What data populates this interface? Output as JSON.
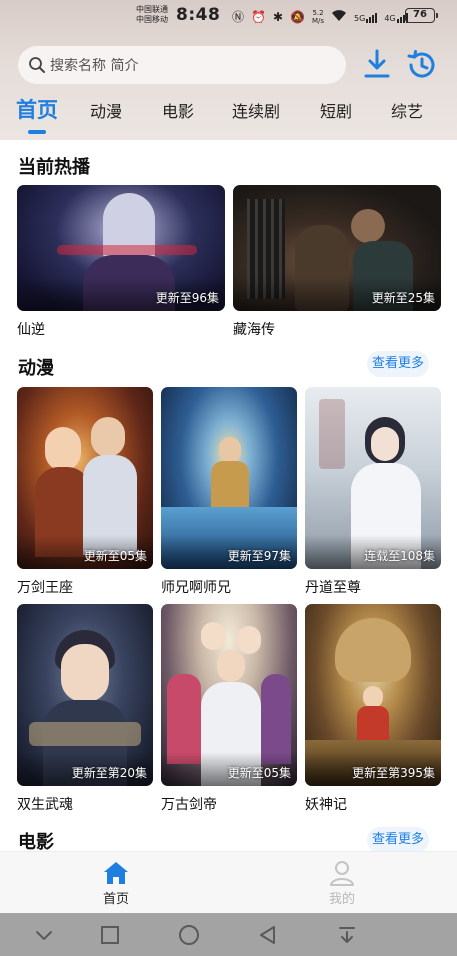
{
  "status_bar": {
    "carrier_1": "中国联通",
    "carrier_2": "中国移动",
    "time": "8:48",
    "speed_value": "5.2",
    "speed_unit": "M/s",
    "network_1": "5G",
    "network_2": "4G",
    "battery": "76"
  },
  "search": {
    "placeholder": "搜索名称 简介"
  },
  "tabs": [
    {
      "label": "首页",
      "active": true
    },
    {
      "label": "动漫",
      "active": false
    },
    {
      "label": "电影",
      "active": false
    },
    {
      "label": "连续剧",
      "active": false
    },
    {
      "label": "短剧",
      "active": false
    },
    {
      "label": "综艺",
      "active": false
    }
  ],
  "sections": {
    "now_playing": {
      "title": "当前热播",
      "items": [
        {
          "title": "仙逆",
          "badge": "更新至96集"
        },
        {
          "title": "藏海传",
          "badge": "更新至25集"
        }
      ]
    },
    "anime": {
      "title": "动漫",
      "more_label": "查看更多",
      "items": [
        {
          "title": "万剑王座",
          "badge": "更新至05集"
        },
        {
          "title": "师兄啊师兄",
          "badge": "更新至97集"
        },
        {
          "title": "丹道至尊",
          "badge": "连载至108集"
        },
        {
          "title": "双生武魂",
          "badge": "更新至第20集"
        },
        {
          "title": "万古剑帝",
          "badge": "更新至05集"
        },
        {
          "title": "妖神记",
          "badge": "更新至第395集"
        }
      ]
    },
    "movies": {
      "title": "电影",
      "more_label": "查看更多"
    }
  },
  "bottom_nav": {
    "home_label": "首页",
    "mine_label": "我的"
  },
  "colors": {
    "accent": "#1f7fe0",
    "inactive_nav": "#b8b8b8",
    "system_nav_bar": "#a3a3a3"
  }
}
